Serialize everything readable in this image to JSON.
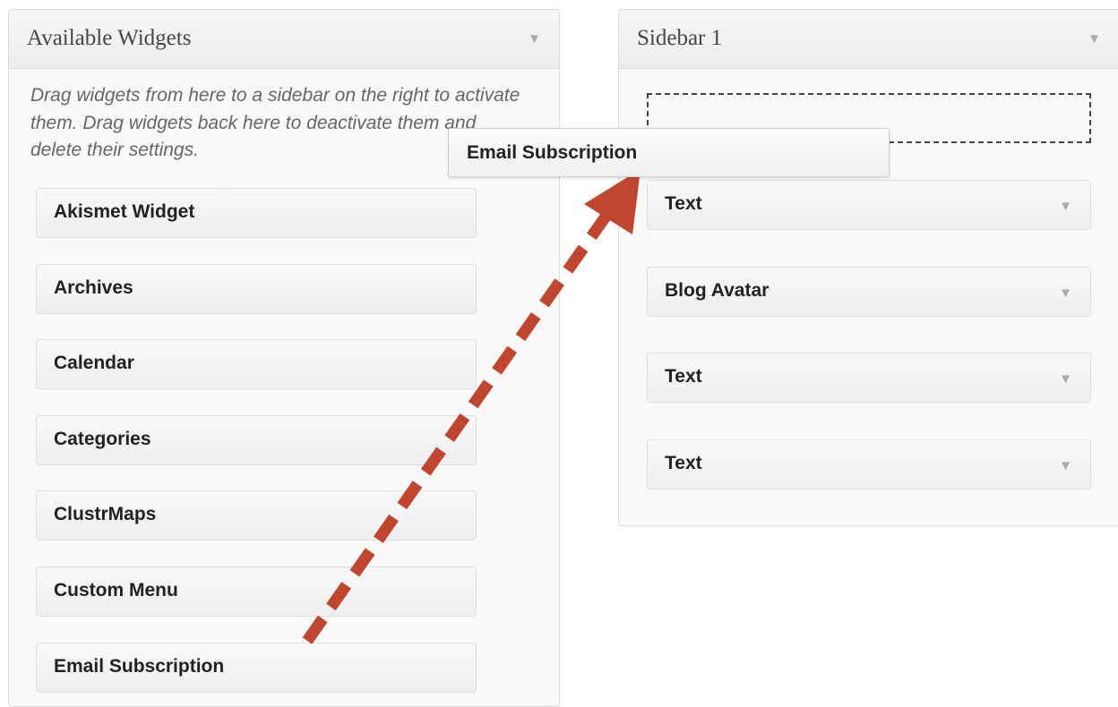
{
  "available": {
    "title": "Available Widgets",
    "collapse_icon": "triangle-down-icon",
    "description": "Drag widgets from here to a sidebar on the right to activate them. Drag widgets back here to deactivate them and delete their settings.",
    "widgets": [
      {
        "label": "Akismet Widget"
      },
      {
        "label": "Archives"
      },
      {
        "label": "Calendar"
      },
      {
        "label": "Categories"
      },
      {
        "label": "ClustrMaps"
      },
      {
        "label": "Custom Menu"
      },
      {
        "label": "Email Subscription"
      }
    ]
  },
  "sidebar": {
    "title": "Sidebar 1",
    "collapse_icon": "triangle-down-icon",
    "widgets": [
      {
        "label": "Text"
      },
      {
        "label": "Blog Avatar"
      },
      {
        "label": "Text"
      },
      {
        "label": "Text"
      }
    ]
  },
  "dragging_widget": {
    "label": "Email Subscription"
  },
  "annotation": {
    "arrow_color": "#c0462d",
    "style": "dashed"
  },
  "colors": {
    "panel_bg": "#f9f9f9",
    "border": "#dcdcdc",
    "text": "#222222"
  },
  "glyphs": {
    "down_arrow": "▼"
  }
}
